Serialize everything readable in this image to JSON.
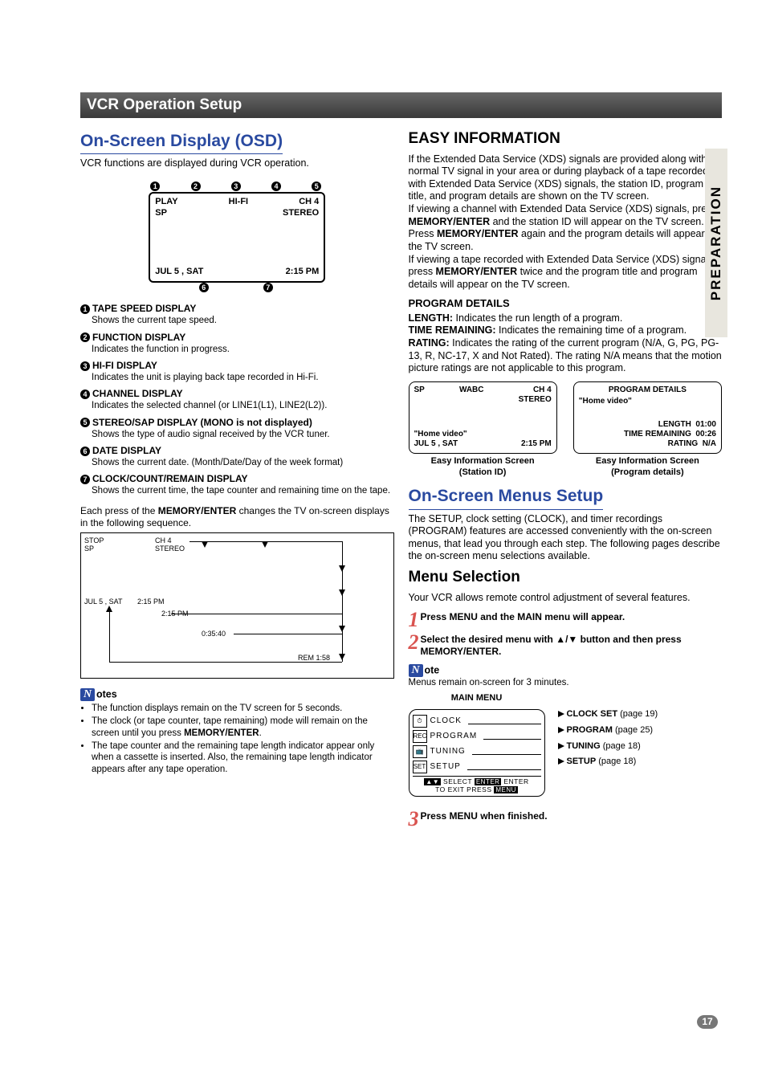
{
  "page_number": "17",
  "side_tab": "PREPARATION",
  "section_title": "VCR Operation Setup",
  "left": {
    "h2": "On-Screen Display (OSD)",
    "intro": "VCR functions are displayed during VCR operation.",
    "osd_screen": {
      "top_ids": [
        "1",
        "2",
        "3",
        "4",
        "5"
      ],
      "row1": {
        "a": "PLAY",
        "b": "HI-FI",
        "c": "CH  4"
      },
      "row2": {
        "a": "SP",
        "c": "STEREO"
      },
      "row3": {
        "a": "JUL   5 , SAT",
        "b": "2:15 PM"
      },
      "bot_ids": [
        "6",
        "7"
      ]
    },
    "items": [
      {
        "n": "1",
        "title": "TAPE SPEED DISPLAY",
        "desc": "Shows the current tape speed."
      },
      {
        "n": "2",
        "title": "FUNCTION DISPLAY",
        "desc": "Indicates the function in progress."
      },
      {
        "n": "3",
        "title": "HI-FI DISPLAY",
        "desc": "Indicates the unit is playing back tape recorded in Hi-Fi."
      },
      {
        "n": "4",
        "title": "CHANNEL DISPLAY",
        "desc": "Indicates the selected channel (or LINE1(L1), LINE2(L2))."
      },
      {
        "n": "5",
        "title": "STEREO/SAP DISPLAY",
        "extra": " (MONO is not displayed)",
        "desc": "Shows the type of audio signal received by the VCR tuner."
      },
      {
        "n": "6",
        "title": "DATE DISPLAY",
        "desc": "Shows the current date. (Month/Date/Day of the week format)"
      },
      {
        "n": "7",
        "title": "CLOCK/COUNT/REMAIN DISPLAY",
        "desc": "Shows the current time, the tape counter and remaining time on the tape."
      }
    ],
    "seq_intro_a": "Each press of the ",
    "seq_intro_b": "MEMORY/ENTER",
    "seq_intro_c": " changes the TV on-screen displays in the following sequence.",
    "seq_labels": {
      "tl1": "STOP",
      "tl2": "SP",
      "tr1": "CH  4",
      "tr2": "STEREO",
      "bl1": "JUL  5 , SAT",
      "bl2": "2:15 PM",
      "mid_a": "2:15 PM",
      "mid_b": "0:35:40",
      "mid_c": "REM 1:58"
    },
    "notes_heading": "otes",
    "notes": [
      "The function displays remain on the TV screen for 5 seconds.",
      "The clock (or tape counter, tape remaining) mode will remain on the screen until you press MEMORY/ENTER.",
      "The tape counter and the remaining tape length indicator appear only when a cassette is inserted. Also, the remaining tape length indicator appears after any tape operation."
    ]
  },
  "right": {
    "easy_h": "EASY INFORMATION",
    "easy_p1": "If the Extended Data Service (XDS) signals are provided along with normal TV signal in your area or during playback of a tape recorded with Extended Data Service (XDS) signals, the station ID, program title, and program details are shown on the TV screen.",
    "easy_p2_a": "If viewing a channel with Extended Data Service (XDS) signals, press ",
    "easy_p2_b": "MEMORY/ENTER",
    "easy_p2_c": " and the station ID will appear on the TV screen. Press ",
    "easy_p2_d": "MEMORY/ENTER",
    "easy_p2_e": " again and the program details will appear on the TV screen.",
    "easy_p3_a": "If viewing a tape recorded with Extended  Data Service (XDS) signals, press ",
    "easy_p3_b": "MEMORY/ENTER",
    "easy_p3_c": " twice and the program title and program details will appear on the TV screen.",
    "prog_h": "PROGRAM DETAILS",
    "prog_length": "LENGTH: Indicates the run length of a program.",
    "prog_time": "TIME REMAINING: Indicates the remaining time of a program.",
    "prog_rating": "RATING: Indicates the rating of the current program (N/A, G, PG, PG-13, R, NC-17, X and Not Rated). The rating N/A means that the motion picture ratings are not applicable to this program.",
    "mini_left": {
      "r1a": "SP",
      "r1b": "WABC",
      "r1c": "CH  4",
      "r1d": "STEREO",
      "r2": "\"Home video\"",
      "r3a": "JUL   5 , SAT",
      "r3b": "2:15 PM",
      "cap1": "Easy Information Screen",
      "cap2": "(Station ID)"
    },
    "mini_right": {
      "r1": "PROGRAM DETAILS",
      "r2": "\"Home video\"",
      "r3a": "LENGTH",
      "r3b": "01:00",
      "r4a": "TIME REMAINING",
      "r4b": "00:26",
      "r5a": "RATING",
      "r5b": "N/A",
      "cap1": "Easy Information Screen",
      "cap2": "(Program details)"
    },
    "menus_h": "On-Screen Menus Setup",
    "menus_intro": "The SETUP, clock setting (CLOCK), and timer recordings (PROGRAM) features are accessed conveniently with the on-screen menus, that lead you through each step. The following pages describe the on-screen menu selections available.",
    "menu_sel_h": "Menu Selection",
    "menu_sel_intro": "Your VCR allows remote control adjustment of several features.",
    "step1": "Press MENU and the MAIN menu will appear.",
    "step2": "Select the desired menu with ▲/▼ button and then press MEMORY/ENTER.",
    "note_single_h": "ote",
    "note_single": "Menus remain on-screen for 3 minutes.",
    "main_menu_label": "MAIN MENU",
    "menu_items": [
      {
        "icon": "⏱",
        "label": "CLOCK",
        "target": "CLOCK SET",
        "page": " (page 19)"
      },
      {
        "icon": "REC",
        "label": "PROGRAM",
        "target": "PROGRAM",
        "page": " (page 25)"
      },
      {
        "icon": "📺",
        "label": "TUNING",
        "target": "TUNING",
        "page": " (page 18)"
      },
      {
        "icon": "SET",
        "label": "SETUP",
        "target": "SETUP",
        "page": " (page 18)"
      }
    ],
    "menu_footer1a": "SELECT",
    "menu_footer1b": "ENTER",
    "menu_footer1c": "ENTER",
    "menu_footer2a": "TO EXIT PRESS",
    "menu_footer2b": "MENU",
    "step3": "Press MENU when finished."
  }
}
